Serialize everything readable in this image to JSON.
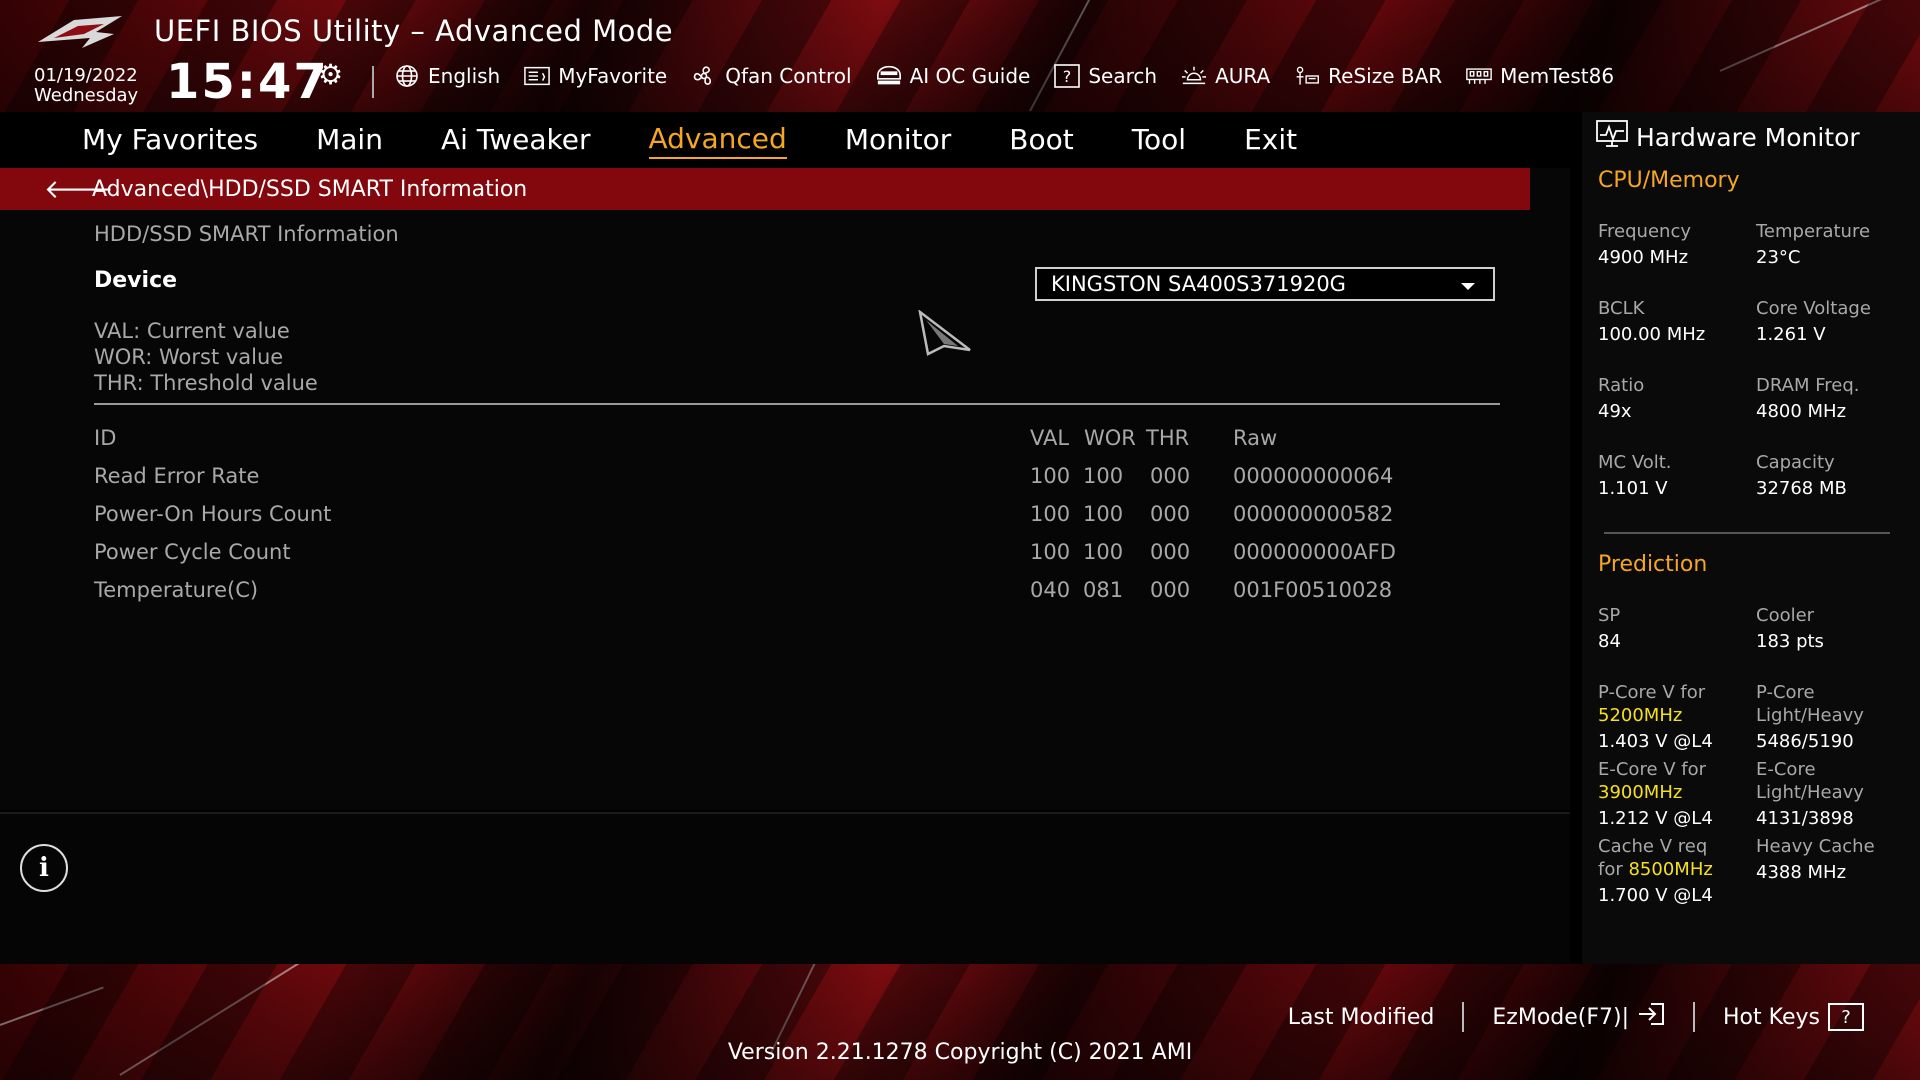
{
  "header": {
    "title": "UEFI BIOS Utility – Advanced Mode",
    "date": "01/19/2022",
    "weekday": "Wednesday",
    "time": "15:47",
    "toolbar": [
      {
        "label": "English",
        "icon": "globe-icon"
      },
      {
        "label": "MyFavorite",
        "icon": "favorite-icon"
      },
      {
        "label": "Qfan Control",
        "icon": "fan-icon"
      },
      {
        "label": "AI OC Guide",
        "icon": "ai-oc-icon"
      },
      {
        "label": "Search",
        "icon": "search-icon"
      },
      {
        "label": "AURA",
        "icon": "aura-icon"
      },
      {
        "label": "ReSize BAR",
        "icon": "resize-bar-icon"
      },
      {
        "label": "MemTest86",
        "icon": "memtest-icon"
      }
    ]
  },
  "nav": {
    "tabs": [
      {
        "label": "My Favorites"
      },
      {
        "label": "Main"
      },
      {
        "label": "Ai Tweaker"
      },
      {
        "label": "Advanced"
      },
      {
        "label": "Monitor"
      },
      {
        "label": "Boot"
      },
      {
        "label": "Tool"
      },
      {
        "label": "Exit"
      }
    ],
    "active": "Advanced"
  },
  "main": {
    "breadcrumb": "Advanced\\HDD/SSD SMART Information",
    "section_title": "HDD/SSD SMART Information",
    "device_label": "Device",
    "device_value": "KINGSTON SA400S371920G",
    "legend": [
      "VAL:  Current value",
      "WOR:  Worst value",
      "THR:  Threshold value"
    ],
    "table": {
      "headers": {
        "id": "ID",
        "val": "VAL",
        "wor": "WOR",
        "thr": "THR",
        "raw": "Raw"
      },
      "rows": [
        {
          "name": "Read Error Rate",
          "val": "100",
          "wor": "100",
          "thr": "000",
          "raw": "000000000064"
        },
        {
          "name": "Power-On Hours Count",
          "val": "100",
          "wor": "100",
          "thr": "000",
          "raw": "000000000582"
        },
        {
          "name": "Power Cycle Count",
          "val": "100",
          "wor": "100",
          "thr": "000",
          "raw": "000000000AFD"
        },
        {
          "name": "Temperature(C)",
          "val": "040",
          "wor": "081",
          "thr": "000",
          "raw": "001F00510028"
        }
      ]
    }
  },
  "hw": {
    "title": "Hardware Monitor",
    "cpu_section": "CPU/Memory",
    "cpu": {
      "frequency_label": "Frequency",
      "frequency": "4900 MHz",
      "temperature_label": "Temperature",
      "temperature": "23°C",
      "bclk_label": "BCLK",
      "bclk": "100.00 MHz",
      "core_voltage_label": "Core Voltage",
      "core_voltage": "1.261 V",
      "ratio_label": "Ratio",
      "ratio": "49x",
      "dram_freq_label": "DRAM Freq.",
      "dram_freq": "4800 MHz",
      "mc_volt_label": "MC Volt.",
      "mc_volt": "1.101 V",
      "capacity_label": "Capacity",
      "capacity": "32768 MB"
    },
    "prediction_section": "Prediction",
    "prediction": {
      "sp_label": "SP",
      "sp": "84",
      "cooler_label": "Cooler",
      "cooler": "183 pts",
      "pcore_v_label": "P-Core V for",
      "pcore_v_freq": "5200MHz",
      "pcore_v": "1.403 V @L4",
      "pcore_lh_label1": "P-Core",
      "pcore_lh_label2": "Light/Heavy",
      "pcore_lh": "5486/5190",
      "ecore_v_label": "E-Core V for",
      "ecore_v_freq": "3900MHz",
      "ecore_v": "1.212 V @L4",
      "ecore_lh_label1": "E-Core",
      "ecore_lh_label2": "Light/Heavy",
      "ecore_lh": "4131/3898",
      "cache_v_label": "Cache V req",
      "cache_v_for": "for",
      "cache_v_freq": "8500MHz",
      "cache_v": "1.700 V @L4",
      "heavy_cache_label": "Heavy Cache",
      "heavy_cache": "4388 MHz"
    }
  },
  "footer": {
    "last_modified": "Last Modified",
    "ezmode": "EzMode(F7)|",
    "hotkeys": "Hot Keys",
    "hotkeys_box": "?",
    "version": "Version 2.21.1278 Copyright (C) 2021 AMI"
  },
  "colors": {
    "accent": "#f5a623",
    "highlight": "#f5e020",
    "breadcrumb_bg": "#82080d"
  }
}
